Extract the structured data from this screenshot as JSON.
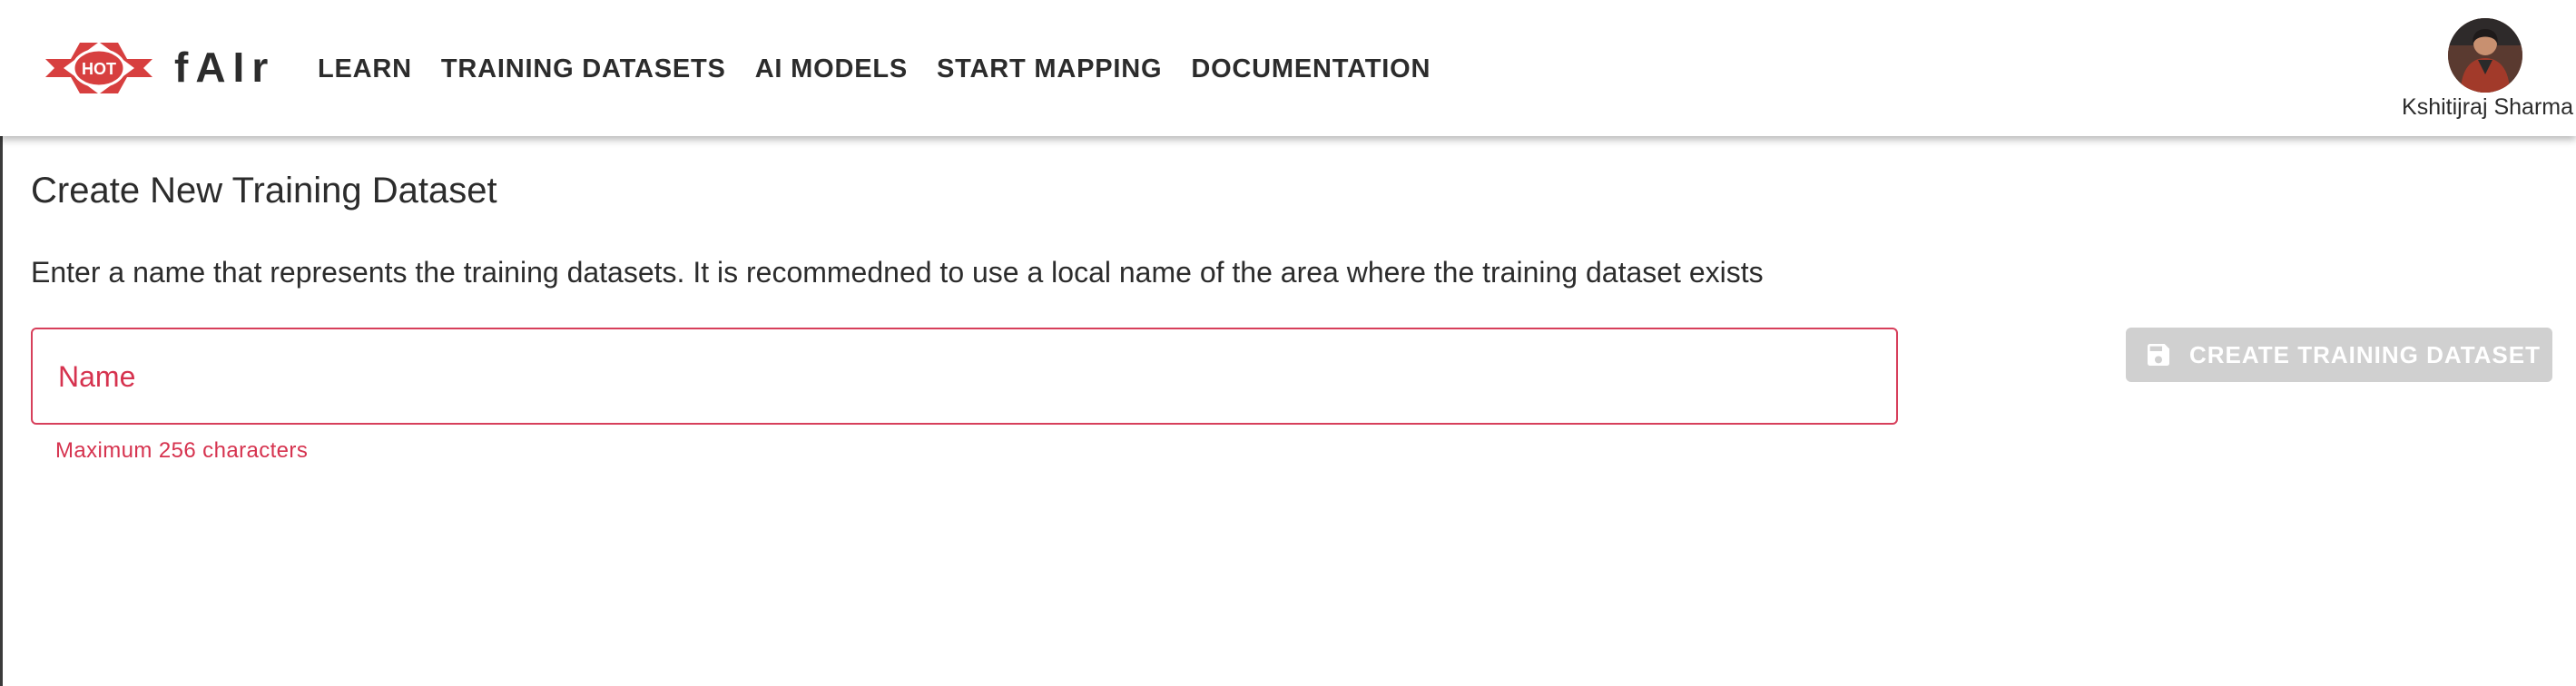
{
  "header": {
    "logo_text": "HOT",
    "brand": "fAIr",
    "nav": [
      {
        "label": "LEARN"
      },
      {
        "label": "TRAINING DATASETS"
      },
      {
        "label": "AI MODELS"
      },
      {
        "label": "START MAPPING"
      },
      {
        "label": "DOCUMENTATION"
      }
    ],
    "user": {
      "name": "Kshitijraj Sharma"
    }
  },
  "main": {
    "title": "Create New Training Dataset",
    "description": "Enter a name that represents the training datasets. It is recommedned to use a local name of the area where the training dataset exists",
    "name_field": {
      "placeholder": "Name",
      "value": "",
      "helper": "Maximum 256 characters"
    },
    "create_button": {
      "label": "CREATE TRAINING DATASET",
      "icon": "save-icon",
      "disabled": true
    }
  },
  "colors": {
    "error": "#d6334f",
    "logo_red": "#d73f3f",
    "disabled_button": "#d0d0d0",
    "text": "#2c2c2c"
  }
}
